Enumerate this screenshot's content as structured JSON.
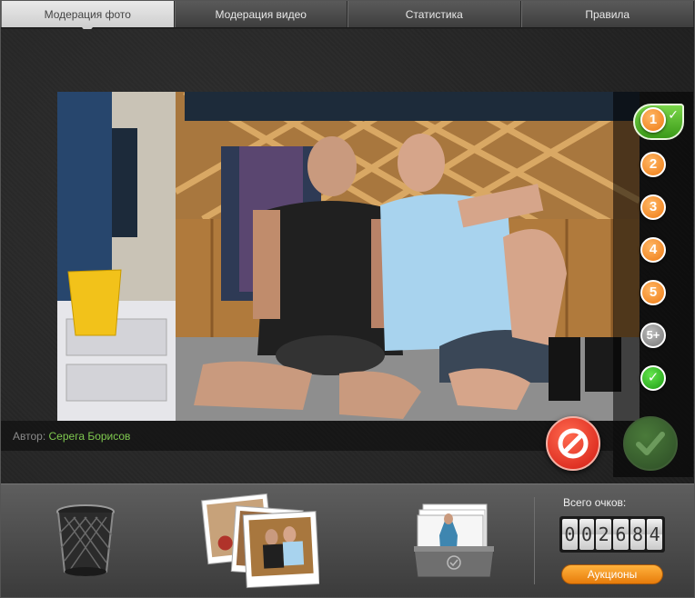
{
  "tabs": [
    {
      "label": "Модерация фото",
      "active": true
    },
    {
      "label": "Модерация видео",
      "active": false
    },
    {
      "label": "Статистика",
      "active": false
    },
    {
      "label": "Правила",
      "active": false
    }
  ],
  "rating": {
    "selected": "1",
    "options": [
      "1",
      "2",
      "3",
      "4",
      "5",
      "5+"
    ]
  },
  "author": {
    "label": "Автор:",
    "name": "Серега Борисов"
  },
  "score": {
    "label": "Всего очков:",
    "digits": [
      "0",
      "0",
      "2",
      "6",
      "8",
      "4"
    ]
  },
  "footer": {
    "auction_label": "Аукционы"
  },
  "colors": {
    "accent_orange": "#ee7a12",
    "approve_green": "#3a9a18",
    "reject_red": "#d31a12",
    "author_green": "#7fc94f"
  },
  "icons": [
    "trash-icon",
    "photo-stack-icon",
    "inbox-icon",
    "reject-icon",
    "approve-icon",
    "checkmark-icon"
  ]
}
